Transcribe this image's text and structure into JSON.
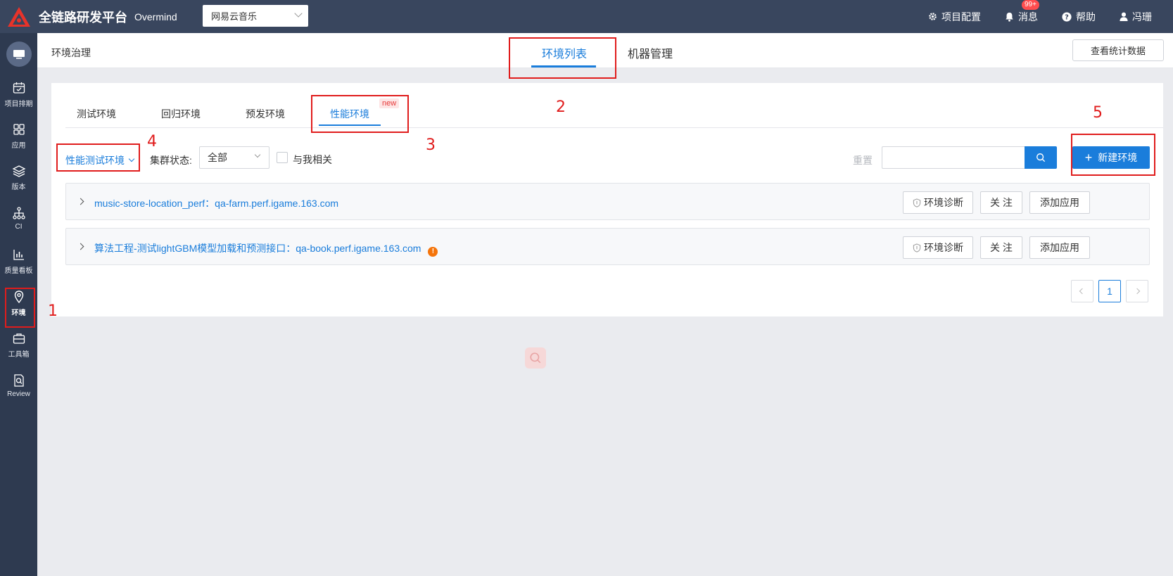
{
  "header": {
    "app_title": "全链路研发平台",
    "app_subtitle": "Overmind",
    "project_select_value": "网易云音乐",
    "actions": {
      "project_config": "项目配置",
      "messages": "消息",
      "messages_badge": "99+",
      "help": "帮助",
      "user": "冯珊"
    }
  },
  "sidebar": {
    "items": [
      {
        "label": "项目排期",
        "icon": "calendar-icon"
      },
      {
        "label": "应用",
        "icon": "grid-icon"
      },
      {
        "label": "版本",
        "icon": "layers-icon"
      },
      {
        "label": "CI",
        "icon": "flow-icon"
      },
      {
        "label": "质量看板",
        "icon": "chart-icon"
      },
      {
        "label": "环境",
        "icon": "location-icon",
        "active": true
      },
      {
        "label": "工具箱",
        "icon": "toolbox-icon"
      },
      {
        "label": "Review",
        "icon": "review-icon"
      }
    ]
  },
  "subheader": {
    "breadcrumb": "环境治理",
    "tabs": [
      {
        "label": "环境列表",
        "active": true
      },
      {
        "label": "机器管理",
        "active": false
      }
    ],
    "stats_button": "查看统计数据"
  },
  "env_tabs": [
    {
      "label": "测试环境",
      "active": false
    },
    {
      "label": "回归环境",
      "active": false
    },
    {
      "label": "预发环境",
      "active": false
    },
    {
      "label": "性能环境",
      "active": true,
      "badge": "new"
    }
  ],
  "filters": {
    "env_type": "性能测试环境",
    "cluster_label": "集群状态:",
    "cluster_value": "全部",
    "related_label": "与我相关",
    "reset": "重置",
    "search_value": "",
    "new_env_button": "新建环境"
  },
  "env_rows": [
    {
      "title": "music-store-location_perf：qa-farm.perf.igame.163.com",
      "warning": false,
      "buttons": {
        "diagnose": "环境诊断",
        "follow": "关 注",
        "add_app": "添加应用"
      }
    },
    {
      "title": "算法工程-测试lightGBM模型加载和预测接口：qa-book.perf.igame.163.com",
      "warning": true,
      "warning_mark": "!",
      "buttons": {
        "diagnose": "环境诊断",
        "follow": "关 注",
        "add_app": "添加应用"
      }
    }
  ],
  "pagination": {
    "current": "1"
  },
  "annotations": [
    "1",
    "2",
    "3",
    "4",
    "5"
  ],
  "colors": {
    "accent": "#1a7ddb",
    "topbar": "#39465e",
    "sidebar": "#2e3a50",
    "annotation": "#e01c1c"
  }
}
